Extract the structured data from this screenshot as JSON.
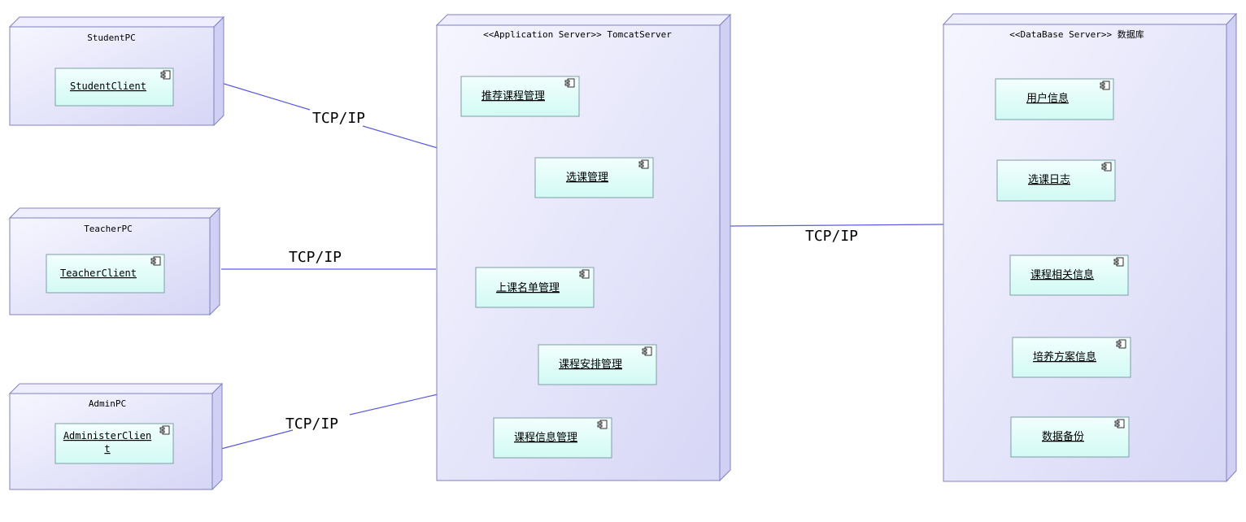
{
  "nodes": {
    "student_pc": {
      "title": "StudentPC",
      "component": "StudentClient"
    },
    "teacher_pc": {
      "title": "TeacherPC",
      "component": "TeacherClient"
    },
    "admin_pc": {
      "title": "AdminPC",
      "component_line1": "AdministerClien",
      "component_line2": "t"
    },
    "app_server": {
      "title": "<<Application Server>> TomcatServer",
      "components": [
        "推荐课程管理",
        "选课管理",
        "上课名单管理",
        "课程安排管理",
        "课程信息管理"
      ]
    },
    "db_server": {
      "title": "<<DataBase Server>> 数据库",
      "components": [
        "用户信息",
        "选课日志",
        "课程相关信息",
        "培养方案信息",
        "数据备份"
      ]
    }
  },
  "links": {
    "student_to_app": "TCP/IP",
    "teacher_to_app": "TCP/IP",
    "admin_to_app": "TCP/IP",
    "app_to_db": "TCP/IP"
  },
  "colors": {
    "node_front": "#e6e6fa",
    "node_side": "#cfd0f4",
    "node_border": "#8080c0",
    "component_fill": "#ddfdf8",
    "component_border": "#7f9fa5",
    "link": "#5b5be0"
  }
}
